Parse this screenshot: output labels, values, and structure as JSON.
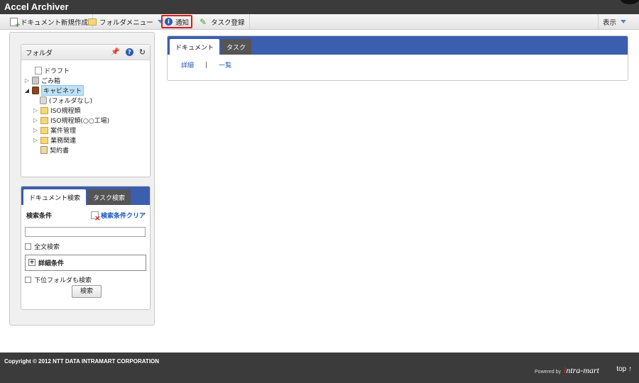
{
  "app": {
    "title": "Accel Archiver"
  },
  "toolbar": {
    "new_document": "ドキュメント新規作成",
    "folder_menu": "フォルダメニュー",
    "notify": "通知",
    "task_register": "タスク登録",
    "display": "表示"
  },
  "folder_panel": {
    "title": "フォルダ",
    "tree": [
      {
        "label": "ドラフト",
        "icon": "document-icon"
      },
      {
        "label": "ごみ箱",
        "icon": "trash-icon"
      },
      {
        "label": "キャビネット",
        "icon": "cabinet-icon",
        "selected": true
      },
      {
        "label": "(フォルダなし)",
        "icon": "cylinder-icon"
      },
      {
        "label": "ISO規程類",
        "icon": "folder-icon"
      },
      {
        "label": "ISO規程類(○○工場)",
        "icon": "folder-icon"
      },
      {
        "label": "案件管理",
        "icon": "folder-icon"
      },
      {
        "label": "業務関連",
        "icon": "folder-icon"
      },
      {
        "label": "契約書",
        "icon": "contract-icon"
      }
    ]
  },
  "search_panel": {
    "tabs": [
      "ドキュメント検索",
      "タスク検索"
    ],
    "conditions_label": "検索条件",
    "clear_label": "検索条件クリア",
    "fulltext_label": "全文検索",
    "detail_label": "詳細条件",
    "subfolder_label": "下位フォルダも検索",
    "search_button": "検索",
    "keyword_value": ""
  },
  "main": {
    "tabs": [
      "ドキュメント",
      "タスク"
    ],
    "links": [
      "詳細",
      "一覧"
    ],
    "separator": "|"
  },
  "footer": {
    "copyright": "Copyright © 2012 NTT DATA INTRAMART CORPORATION",
    "powered_by": "Powered by",
    "brand": "intra-mart",
    "top_link": "top ↑"
  }
}
